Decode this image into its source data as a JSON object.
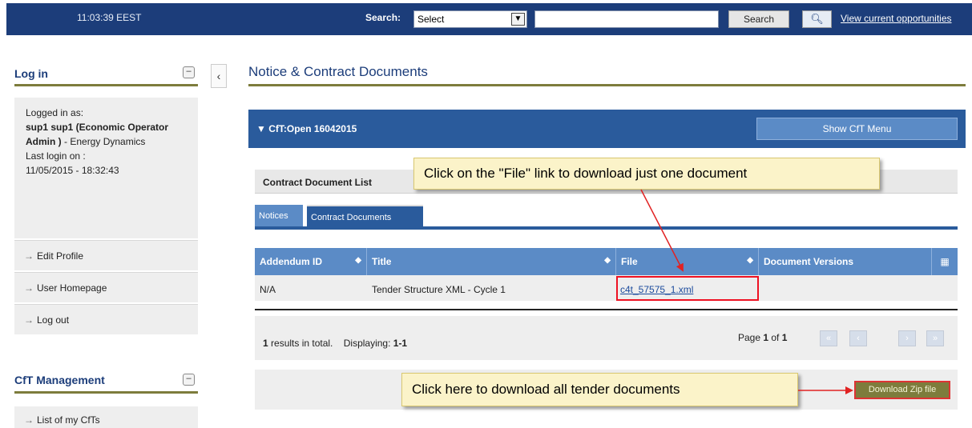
{
  "topbar": {
    "clock": "11:03:39 EEST",
    "search_label": "Search:",
    "search_select_value": "Select",
    "search_input_value": "",
    "search_button": "Search",
    "opportunities_link": "View current opportunities"
  },
  "login_panel": {
    "title": "Log in",
    "logged_in_label": "Logged in as:",
    "user_name": "sup1 sup1 (Economic Operator Admin )",
    "user_org": " - Energy Dynamics",
    "last_login_label": "Last login on :",
    "last_login_value": "11/05/2015 - 18:32:43",
    "menu": [
      "Edit Profile",
      "User Homepage",
      "Log out"
    ]
  },
  "cft_panel": {
    "title": "CfT Management",
    "menu": [
      "List of my CfTs"
    ]
  },
  "main": {
    "page_title": "Notice & Contract Documents",
    "cft_title": "CfT:Open 16042015",
    "show_menu_button": "Show CfT Menu",
    "list_title": "Contract Document List",
    "tabs": [
      {
        "label": "Notices",
        "active": false
      },
      {
        "label": "Contract Documents",
        "active": true
      }
    ],
    "table": {
      "columns": [
        "Addendum ID",
        "Title",
        "File",
        "Document Versions"
      ],
      "rows": [
        {
          "addendum_id": "N/A",
          "title": "Tender Structure XML - Cycle 1",
          "file": "c4t_57575_1.xml",
          "versions": ""
        }
      ]
    },
    "results_count": "1",
    "results_text": " results in total.",
    "displaying_label": "Displaying: ",
    "displaying_value": "1-1",
    "page_label": "Page ",
    "page_current": "1",
    "page_of": " of ",
    "page_total": "1",
    "download_zip_button": "Download Zip file"
  },
  "annotations": {
    "file_callout": "Click on the \"File\" link to download just one document",
    "zip_callout": "Click here to download all tender documents"
  },
  "colors": {
    "header_blue": "#1c3d7a",
    "panel_blue": "#2a5b9c",
    "olive": "#7d7c3c",
    "callout_bg": "#fbf3c9",
    "highlight_red": "#e12222"
  }
}
